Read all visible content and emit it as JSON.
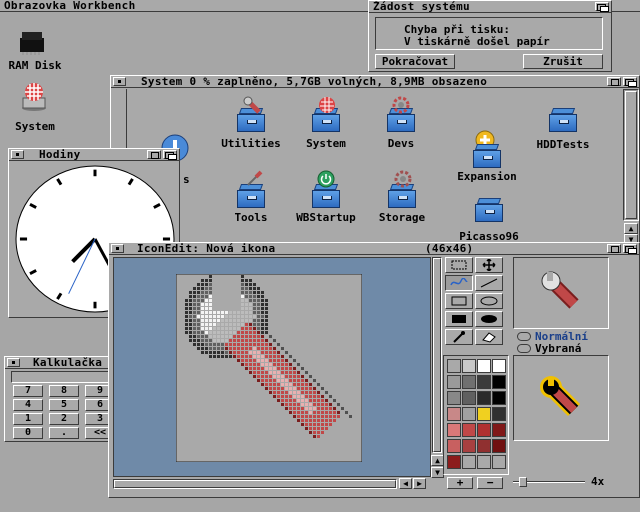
{
  "screen": {
    "title": "Obrazovka Workbench"
  },
  "desktop_icons": [
    {
      "label": "RAM Disk",
      "icon": "ram-disk-icon"
    },
    {
      "label": "System",
      "icon": "system-disk-icon"
    }
  ],
  "request": {
    "title": "Žádost systému",
    "line1": "Chyba při tisku:",
    "line2": "V tiskárně došel papír",
    "ok_label": "Pokračovat",
    "cancel_label": "Zrušit"
  },
  "system_window": {
    "title": "System  0 % zaplněno, 5,7GB volných, 8,9MB obsazeno",
    "partial_icon_label": "s",
    "icons": [
      {
        "label": "Utilities",
        "icon": "utilities-drawer-icon"
      },
      {
        "label": "System",
        "icon": "system-drawer-icon"
      },
      {
        "label": "Devs",
        "icon": "devs-drawer-icon"
      },
      {
        "label": "HDDTests",
        "icon": "hddtests-drawer-icon"
      },
      {
        "label": "Expansion",
        "icon": "expansion-drawer-icon"
      },
      {
        "label": "Tools",
        "icon": "tools-drawer-icon"
      },
      {
        "label": "WBStartup",
        "icon": "wbstartup-drawer-icon"
      },
      {
        "label": "Storage",
        "icon": "storage-drawer-icon"
      },
      {
        "label": "Picasso96",
        "icon": "picasso96-drawer-icon"
      }
    ]
  },
  "clock": {
    "title": "Hodiny",
    "hour": 7,
    "minute": 25,
    "second": 34
  },
  "calculator": {
    "title": "Kalkulačka",
    "display": "0",
    "buttons": [
      [
        "7",
        "8",
        "9",
        "CA",
        "CE"
      ],
      [
        "4",
        "5",
        "6",
        "×",
        "÷"
      ],
      [
        "1",
        "2",
        "3",
        "+",
        "-"
      ],
      [
        "0",
        ".",
        "<<",
        "+/-",
        "="
      ]
    ]
  },
  "iconedit": {
    "title": "IconEdit: Nová ikona",
    "size": "(46x46)",
    "normal_label": "Normální",
    "selected_label": "Vybraná",
    "zoom": "4x",
    "zoom_level": 0.1,
    "add_label": "+",
    "remove_label": "−",
    "palette": [
      "#a9a9a9",
      "#c8c8c8",
      "#ffffff",
      "#ffffff",
      "#9a9a9a",
      "#707070",
      "#3b3b3b",
      "#000000",
      "#888888",
      "#606060",
      "#2a2a2a",
      "#000000",
      "#c88888",
      "#a0a0a0",
      "#f0d020",
      "#303030",
      "#d87878",
      "#c04848",
      "#b03030",
      "#801818",
      "#c86060",
      "#a84040",
      "#903030",
      "#701010",
      "#8c1c1c",
      "#a9a9a9",
      "#a9a9a9",
      "#a9a9a9"
    ]
  },
  "colors": {
    "bg": "#a6a6a6",
    "drawer_blue": "#4a8ad8",
    "wrench_red": "#c04848"
  }
}
